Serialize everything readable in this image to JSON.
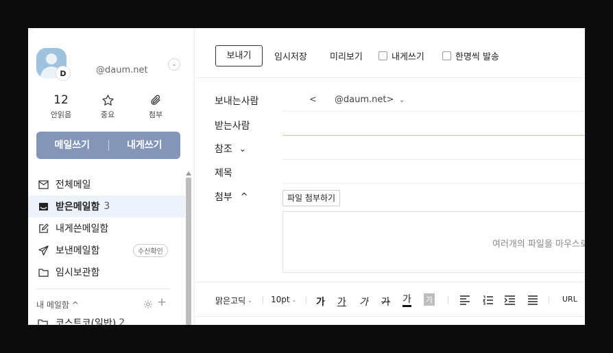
{
  "account": {
    "badge": "D",
    "email": "@daum.net",
    "toggle_glyph": "⌄"
  },
  "stats": [
    {
      "value": "12",
      "label": "안읽음"
    },
    {
      "label": "중요",
      "icon": "star-icon"
    },
    {
      "label": "첨부",
      "icon": "paperclip-icon"
    }
  ],
  "write_buttons": {
    "compose": "메일쓰기",
    "to_self": "내게쓰기"
  },
  "menu": [
    {
      "label": "전체메일",
      "icon": "mail-icon"
    },
    {
      "label": "받은메일함",
      "count": "3",
      "icon": "inbox-icon",
      "active": true
    },
    {
      "label": "내게쓴메일함",
      "icon": "edit-icon"
    },
    {
      "label": "보낸메일함",
      "icon": "send-icon",
      "pill": "수신확인"
    },
    {
      "label": "임시보관함",
      "icon": "folder-icon"
    }
  ],
  "my_mail": {
    "label": "내 메일함 ^",
    "plus": "+"
  },
  "partial_folder": {
    "label": "코스트코(일반)",
    "count": "2"
  },
  "toolbar": {
    "send": "보내기",
    "save_draft": "임시저장",
    "preview": "미리보기",
    "to_self": "내게쓰기",
    "one_by_one": "한명씩 발송"
  },
  "fields": {
    "sender_label": "보내는사람",
    "sender_prefix": "<",
    "sender_value": "@daum.net>",
    "sender_caret": "⌄",
    "to_label": "받는사람",
    "cc_label": "참조",
    "cc_caret": "⌄",
    "subject_label": "제목",
    "attach_label": "첨부",
    "attach_caret": "^"
  },
  "attachment": {
    "button": "파일 첨부하기",
    "drop_hint": "여러개의 파일을 마우스로 끌어놓으세요"
  },
  "editor": {
    "font": "맑은고딕",
    "size": "10pt",
    "bold": "가",
    "underline": "가",
    "italic": "가",
    "strike": "가",
    "font_color": "가",
    "bg_color": "가",
    "url": "URL",
    "caret": "⌄"
  },
  "colors": {
    "write_box": "#8495b8",
    "focus_line": "#f5d21b",
    "active_menu_bg": "#eef3fb"
  }
}
